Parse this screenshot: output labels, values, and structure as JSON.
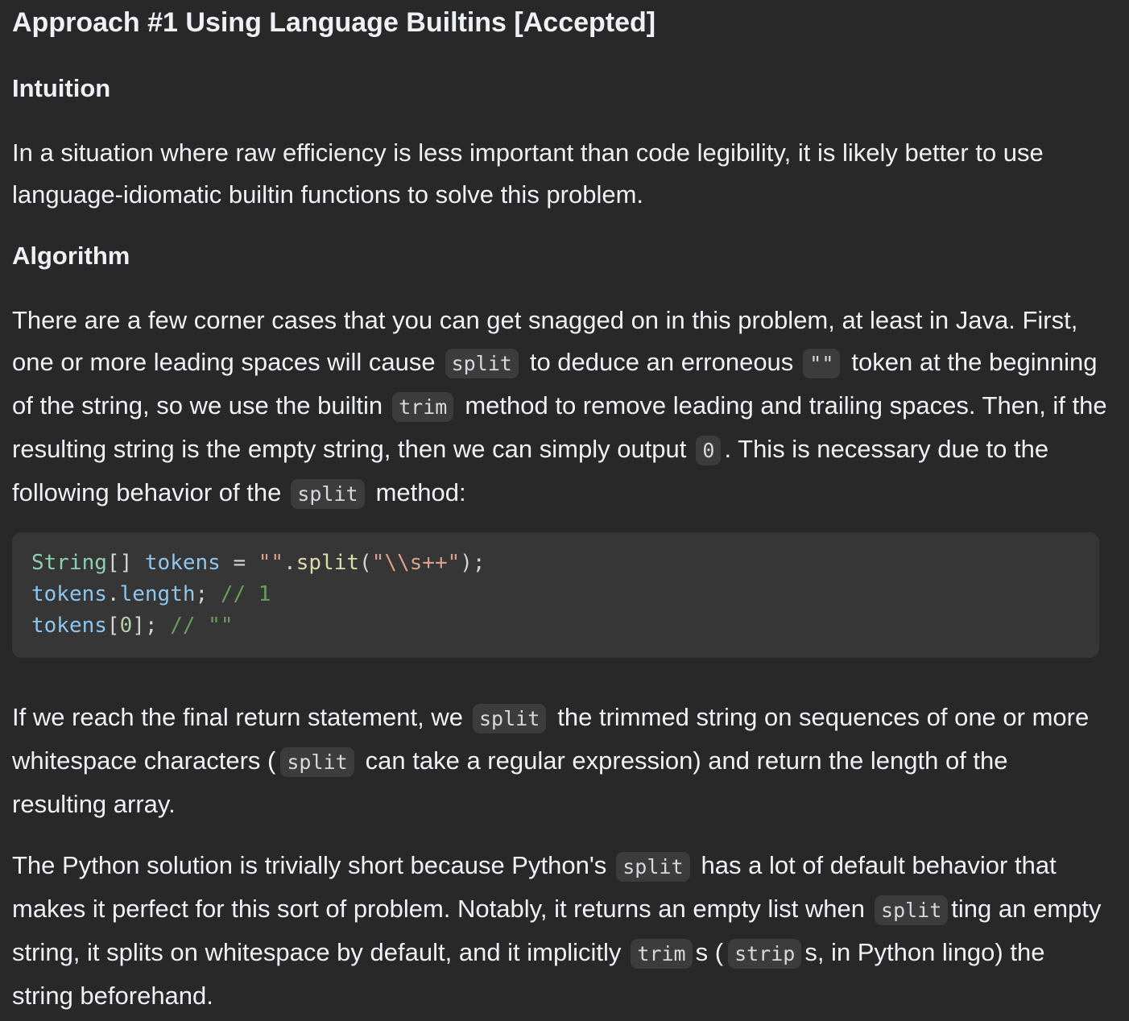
{
  "title": "Approach #1 Using Language Builtins [Accepted]",
  "intuition": {
    "heading": "Intuition",
    "text": "In a situation where raw efficiency is less important than code legibility, it is likely better to use language-idiomatic builtin functions to solve this problem."
  },
  "algorithm": {
    "heading": "Algorithm",
    "p1": {
      "a": "There are a few corner cases that you can get snagged on in this problem, at least in Java. First, one or more leading spaces will cause",
      "code1": "split",
      "b": "to deduce an erroneous",
      "code2": "\"\"",
      "c": "token at the beginning of the string, so we use the builtin",
      "code3": "trim",
      "d": "method to remove leading and trailing spaces. Then, if the resulting string is the empty string, then we can simply output",
      "code4": "0",
      "e": ". This is necessary due to the following behavior of the",
      "code5": "split",
      "f": "method:"
    },
    "code_block": {
      "line1": {
        "type": "String",
        "brackets": "[]",
        "var": "tokens",
        "eq": " = ",
        "str1": "\"\"",
        "dot": ".",
        "fn": "split",
        "open": "(",
        "str2": "\"\\\\s++\"",
        "close": ");"
      },
      "line2": {
        "var": "tokens",
        "dot": ".",
        "prop": "length",
        "semi": "; ",
        "comment": "// 1"
      },
      "line3": {
        "var": "tokens",
        "open": "[",
        "idx": "0",
        "close": "]; ",
        "comment": "// \"\""
      }
    },
    "p2": {
      "a": "If we reach the final return statement, we",
      "code1": "split",
      "b": "the trimmed string on sequences of one or more whitespace characters (",
      "code2": "split",
      "c": "can take a regular expression) and return the length of the resulting array."
    },
    "p3": {
      "a": "The Python solution is trivially short because Python's",
      "code1": "split",
      "b": "has a lot of default behavior that makes it perfect for this sort of problem. Notably, it returns an empty list when",
      "code2": "split",
      "c": "ting an empty string, it splits on whitespace by default, and it implicitly",
      "code3": "trim",
      "d": "s (",
      "code4": "strip",
      "e": "s, in Python lingo) the string beforehand."
    }
  }
}
